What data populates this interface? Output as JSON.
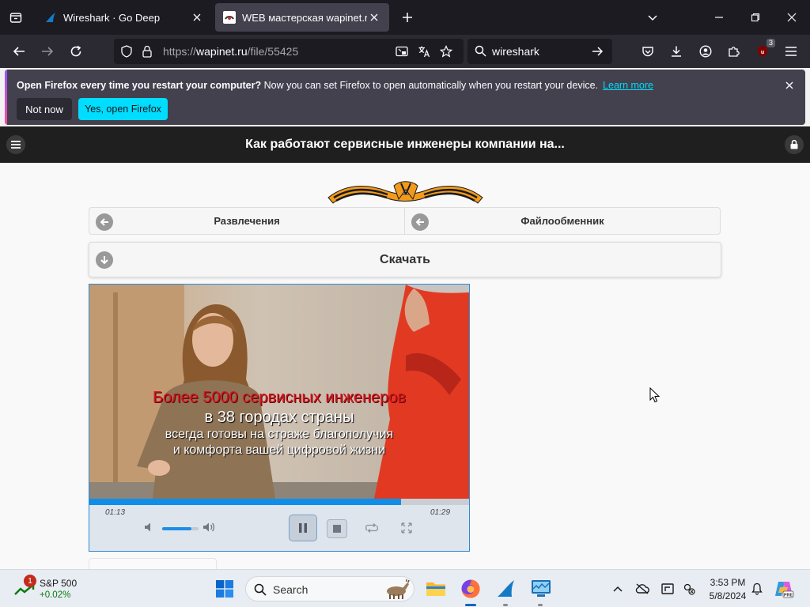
{
  "browser": {
    "tabs": [
      {
        "title": "Wireshark · Go Deep",
        "active": false
      },
      {
        "title": "WEB мастерская wapinet.ru - I",
        "active": true
      }
    ],
    "url": {
      "prefix": "https://",
      "host": "wapinet.ru",
      "path": "/file/55425"
    },
    "search_query": "wireshark",
    "extension_badge": "3"
  },
  "notification": {
    "title": "Open Firefox every time you restart your computer?",
    "message": "Now you can set Firefox to open automatically when you restart your device.",
    "learn_more": "Learn more",
    "not_now": "Not now",
    "yes_open": "Yes, open Firefox"
  },
  "site": {
    "title": "Как работают сервисные инженеры компании на...",
    "nav_left": "Развлечения",
    "nav_right": "Файлообменник",
    "download": "Скачать"
  },
  "player": {
    "subtitle_line1": "Более 5000 сервисных инженеров",
    "subtitle_line2": "в 38 городах страны",
    "subtitle_line3": "всегда готовы на страже благополучия",
    "subtitle_line4": "и комфорта вашей цифровой жизни",
    "current_time": "01:13",
    "total_time": "01:29",
    "progress_fraction": 0.82,
    "volume_fraction": 0.8,
    "state": "playing"
  },
  "taskbar": {
    "stock_name": "S&P 500",
    "stock_change": "+0.02%",
    "stock_badge": "1",
    "search_placeholder": "Search",
    "time": "3:53 PM",
    "date": "5/8/2024"
  },
  "colors": {
    "firefox_accent": "#00ddff",
    "player_progress": "#0f8ee9",
    "subtitle_red": "#d6141c"
  }
}
